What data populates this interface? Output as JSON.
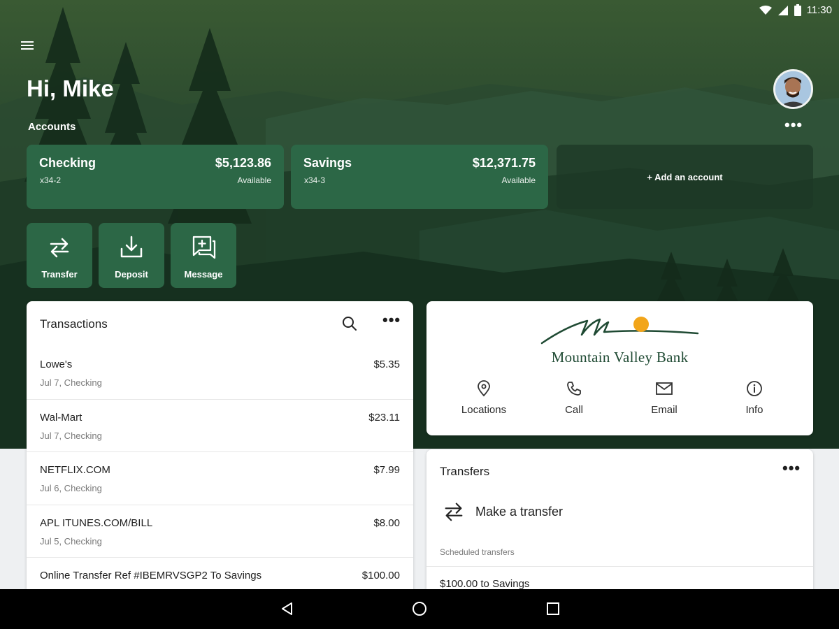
{
  "status_bar": {
    "time": "11:30"
  },
  "header": {
    "greeting": "Hi, Mike",
    "accounts_label": "Accounts",
    "more": "•••"
  },
  "accounts": [
    {
      "name": "Checking",
      "number": "x34-2",
      "balance": "$5,123.86",
      "balance_label": "Available"
    },
    {
      "name": "Savings",
      "number": "x34-3",
      "balance": "$12,371.75",
      "balance_label": "Available"
    }
  ],
  "add_account": "+ Add an account",
  "actions": [
    {
      "label": "Transfer",
      "icon": "transfer-icon"
    },
    {
      "label": "Deposit",
      "icon": "deposit-icon"
    },
    {
      "label": "Message",
      "icon": "message-icon"
    }
  ],
  "transactions": {
    "title": "Transactions",
    "more": "•••",
    "items": [
      {
        "merchant": "Lowe's",
        "detail": "Jul 7, Checking",
        "amount": "$5.35"
      },
      {
        "merchant": "Wal-Mart",
        "detail": "Jul 7, Checking",
        "amount": "$23.11"
      },
      {
        "merchant": "NETFLIX.COM",
        "detail": "Jul 6, Checking",
        "amount": "$7.99"
      },
      {
        "merchant": "APL ITUNES.COM/BILL",
        "detail": "Jul 5, Checking",
        "amount": "$8.00"
      },
      {
        "merchant": "Online Transfer Ref #IBEMRVSGP2 To Savings",
        "detail": "",
        "amount": "$100.00"
      }
    ]
  },
  "bank": {
    "name": "Mountain Valley Bank",
    "accent": "#f2a51a",
    "contacts": [
      {
        "label": "Locations",
        "icon": "location-pin-icon"
      },
      {
        "label": "Call",
        "icon": "phone-icon"
      },
      {
        "label": "Email",
        "icon": "email-icon"
      },
      {
        "label": "Info",
        "icon": "info-icon"
      }
    ]
  },
  "transfers": {
    "title": "Transfers",
    "more": "•••",
    "make_transfer": "Make a transfer",
    "scheduled_label": "Scheduled transfers",
    "scheduled_items": [
      "$100.00 to Savings"
    ]
  },
  "colors": {
    "brand_green": "#2c6746",
    "hero_dark": "#183522"
  }
}
